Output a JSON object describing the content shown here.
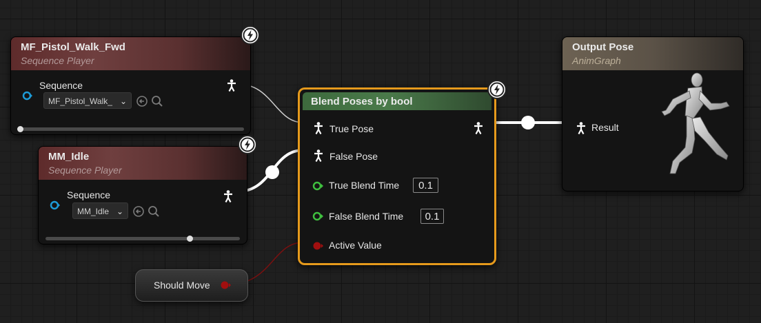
{
  "nodes": {
    "mf_walk": {
      "title": "MF_Pistol_Walk_Fwd",
      "subtitle": "Sequence Player",
      "pin_label": "Sequence",
      "sequence_value": "MF_Pistol_Walk_",
      "play_position": 0.0
    },
    "mm_idle": {
      "title": "MM_Idle",
      "subtitle": "Sequence Player",
      "pin_label": "Sequence",
      "sequence_value": "MM_Idle",
      "play_position": 0.71
    },
    "blend": {
      "title": "Blend Poses by bool",
      "true_pose": "True Pose",
      "false_pose": "False Pose",
      "true_blend_time_label": "True Blend Time",
      "true_blend_time_value": "0.1",
      "false_blend_time_label": "False Blend Time",
      "false_blend_time_value": "0.1",
      "active_value_label": "Active Value"
    },
    "output": {
      "title": "Output Pose",
      "subtitle": "AnimGraph",
      "result_label": "Result"
    },
    "should_move": {
      "label": "Should Move"
    }
  },
  "colors": {
    "pose_pin": "#ffffff",
    "bool_pin": "#8b0000",
    "float_pin": "#3fbf3f",
    "object_pin": "#1d9bd7",
    "selection_outline": "#e69a1c"
  },
  "icons": {
    "fast_path": "lightning-bolt-icon",
    "pose": "pose-figure-icon",
    "browse": "arrow-left-circle-icon",
    "find": "magnifier-icon"
  }
}
